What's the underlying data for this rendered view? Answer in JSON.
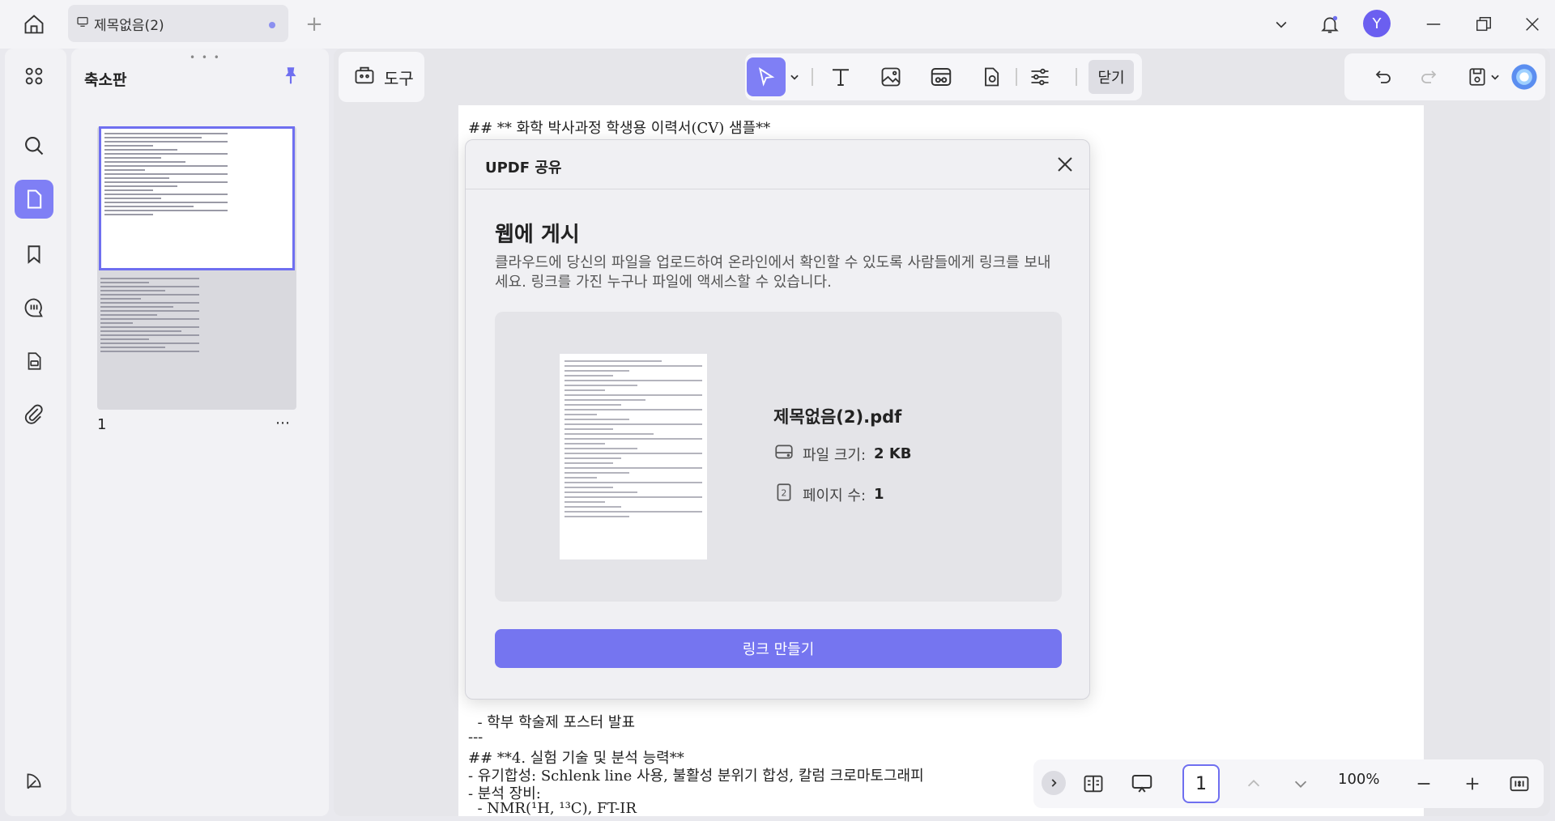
{
  "titlebar": {
    "tab_title": "제목없음(2)",
    "avatar_letter": "Y"
  },
  "thumbs": {
    "title": "축소판",
    "page_number": "1",
    "more": "⋯"
  },
  "toolbar": {
    "tool_label": "도구",
    "close_label": "닫기"
  },
  "document": {
    "lines_top": [
      "## ** 화학 박사과정 학생용 이력서(CV) 샘플**"
    ],
    "lines_bottom": [
      "  - 학부 학술제 포스터 발표",
      "---",
      "## **4. 실험 기술 및 분석 능력**",
      "- 유기합성: Schlenk line 사용, 불활성 분위기 합성, 칼럼 크로마토그래피",
      "- 분석 장비:",
      "  - NMR(¹H, ¹³C), FT-IR"
    ]
  },
  "bottombar": {
    "page_value": "1",
    "zoom": "100%"
  },
  "modal": {
    "title": "UPDF 공유",
    "heading": "웹에 게시",
    "description": "클라우드에 당신의 파일을 업로드하여 온라인에서 확인할 수 있도록 사람들에게 링크를 보내세요. 링크를 가진 누구나 파일에 액세스할 수 있습니다.",
    "file_name": "제목없음(2).pdf",
    "size_label": "파일 크기:",
    "size_value": "2 KB",
    "pages_label": "페이지 수:",
    "pages_value": "1",
    "create_link": "링크 만들기"
  },
  "colors": {
    "accent": "#7575f0",
    "active_rail": "#7f7ff5"
  }
}
